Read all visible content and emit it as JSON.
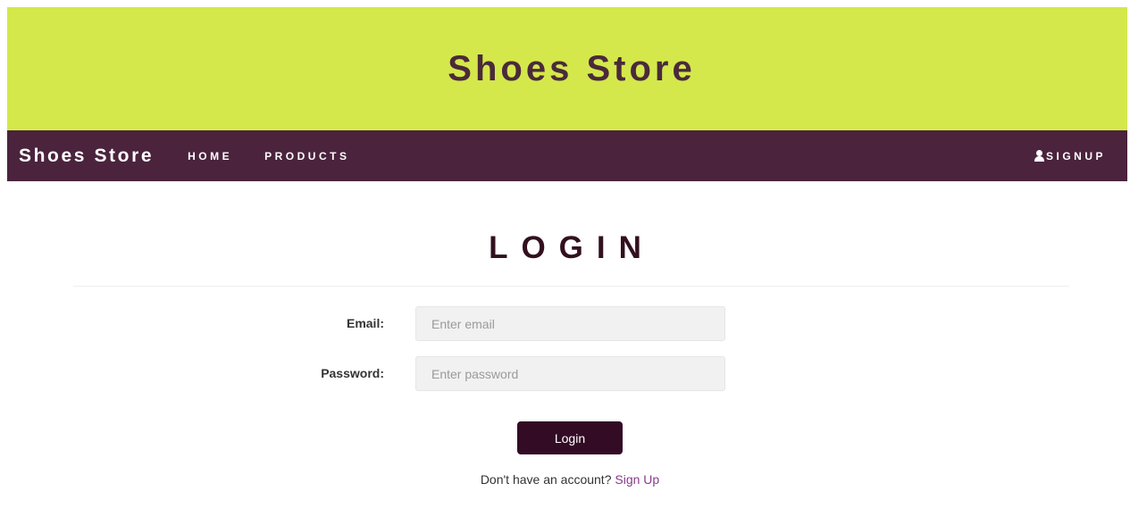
{
  "banner": {
    "title": "Shoes Store"
  },
  "navbar": {
    "brand": "Shoes Store",
    "links": [
      {
        "label": "HOME"
      },
      {
        "label": "PRODUCTS"
      }
    ],
    "signup": {
      "label": "SIGNUP",
      "icon": "user-icon"
    }
  },
  "login": {
    "heading": "LOGIN",
    "email": {
      "label": "Email:",
      "value": "",
      "placeholder": "Enter email"
    },
    "password": {
      "label": "Password:",
      "value": "",
      "placeholder": "Enter password"
    },
    "submit_label": "Login",
    "signup_prompt": "Don't have an account?",
    "signup_link": "Sign Up"
  },
  "colors": {
    "banner_bg": "#d4e84b",
    "navbar_bg": "#4b233d",
    "button_bg": "#330b25",
    "link": "#8a3a8a"
  }
}
